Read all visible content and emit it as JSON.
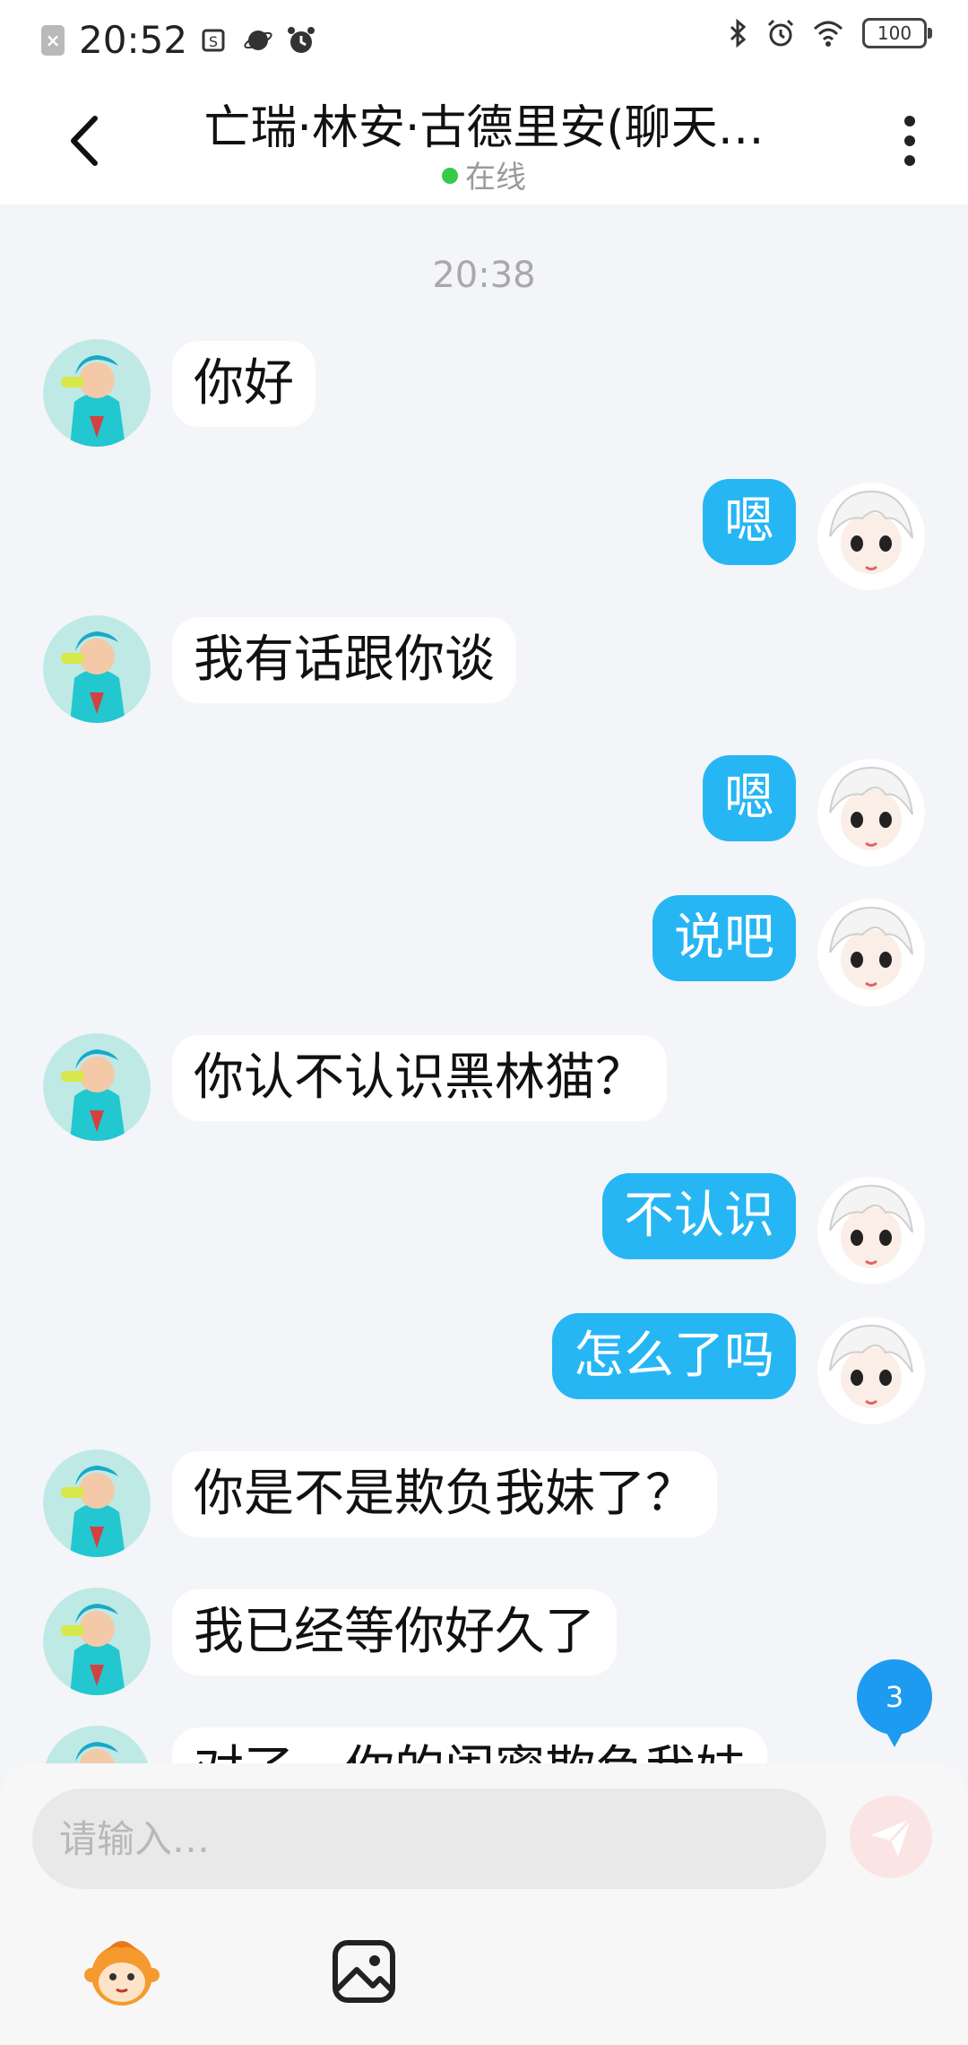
{
  "status_bar": {
    "time": "20:52",
    "battery": "100",
    "left_icons": [
      "sim-icon",
      "data-icon",
      "planet-icon",
      "alarm-icon"
    ],
    "right_icons": [
      "bluetooth-icon",
      "alarm-icon",
      "wifi-icon",
      "battery-icon"
    ]
  },
  "header": {
    "title": "亡瑞·林安·古德里安(聊天…",
    "status": "在线",
    "status_color": "#38c948"
  },
  "chat": {
    "timestamp": "20:38",
    "messages": [
      {
        "side": "left",
        "text": "你好"
      },
      {
        "side": "right",
        "text": "嗯"
      },
      {
        "side": "left",
        "text": "我有话跟你谈"
      },
      {
        "side": "right",
        "text": "嗯"
      },
      {
        "side": "right",
        "text": "说吧"
      },
      {
        "side": "left",
        "text": "你认不认识黑林猫？"
      },
      {
        "side": "right",
        "text": "不认识"
      },
      {
        "side": "right",
        "text": "怎么了吗"
      },
      {
        "side": "left",
        "text": "你是不是欺负我妹了？"
      },
      {
        "side": "left",
        "text": "我已经等你好久了"
      },
      {
        "side": "left",
        "text": "对了，你的闺蜜欺负我妹"
      }
    ],
    "unread_count": "3"
  },
  "input": {
    "placeholder": "请输入…"
  },
  "colors": {
    "outgoing_bubble": "#27b6f4",
    "incoming_bubble": "#ffffff",
    "background": "#f3f5f8",
    "send_button": "#fbe5e4",
    "unread_badge": "#1d9bf0"
  }
}
